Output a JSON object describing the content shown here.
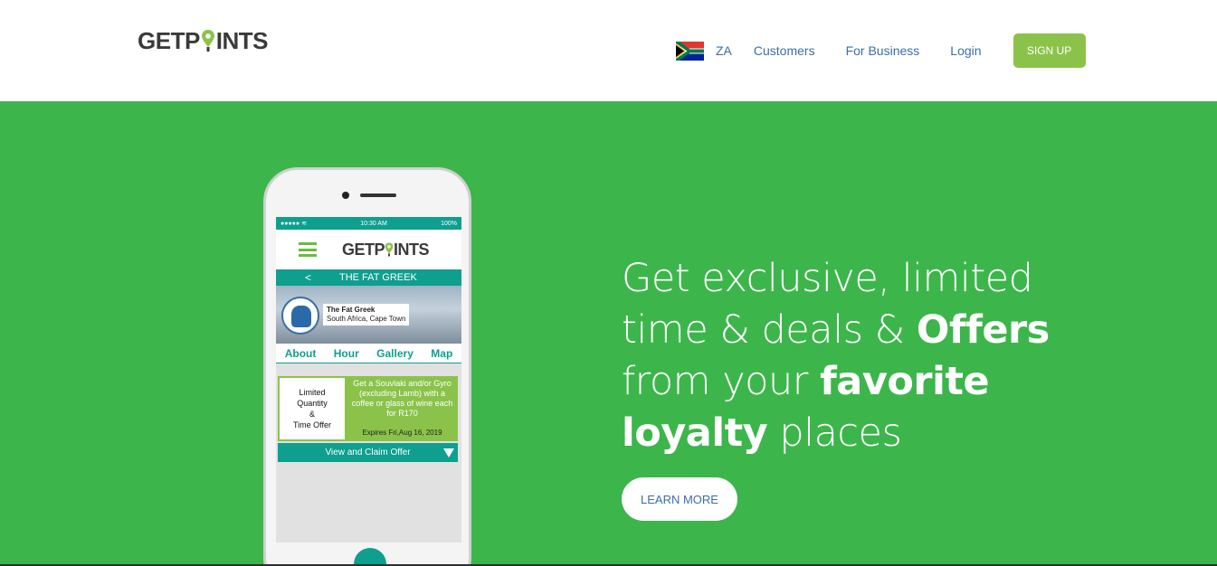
{
  "header": {
    "logo_prefix": "GETP",
    "logo_suffix": "INTS",
    "language": "ZA",
    "nav": {
      "customers": "Customers",
      "business": "For Business",
      "login": "Login"
    },
    "signup": "SIGN UP"
  },
  "hero": {
    "headline_line1": "Get exclusive, limited",
    "headline_line2a": "time & deals & ",
    "headline_line2b": "Offers",
    "headline_line3a": "from your ",
    "headline_line3b": "favorite",
    "headline_line4a": "loyalty",
    "headline_line4b": " places",
    "cta": "LEARN MORE",
    "colors": {
      "green": "#3cb64b",
      "accent": "#8bc34a",
      "link": "#3a6ea8"
    }
  },
  "phone": {
    "status_time": "10:30 AM",
    "status_battery": "100%",
    "app_logo_prefix": "GETP",
    "app_logo_suffix": "INTS",
    "venue_title": "THE FAT GREEK",
    "venue_name": "The Fat Greek",
    "venue_location": "South Africa, Cape Town",
    "tabs": [
      "About",
      "Hour",
      "Gallery",
      "Map"
    ],
    "offer_badge_line1": "Limited",
    "offer_badge_line2": "Quantity",
    "offer_badge_line3": "&",
    "offer_badge_line4": "Time Offer",
    "offer_text": "Get a Souvlaki and/or Gyro (excluding Lamb) with a coffee or glass of wine each for R170",
    "offer_expiry": "Expires Fri,Aug 16, 2019",
    "claim": "View and Claim Offer"
  }
}
